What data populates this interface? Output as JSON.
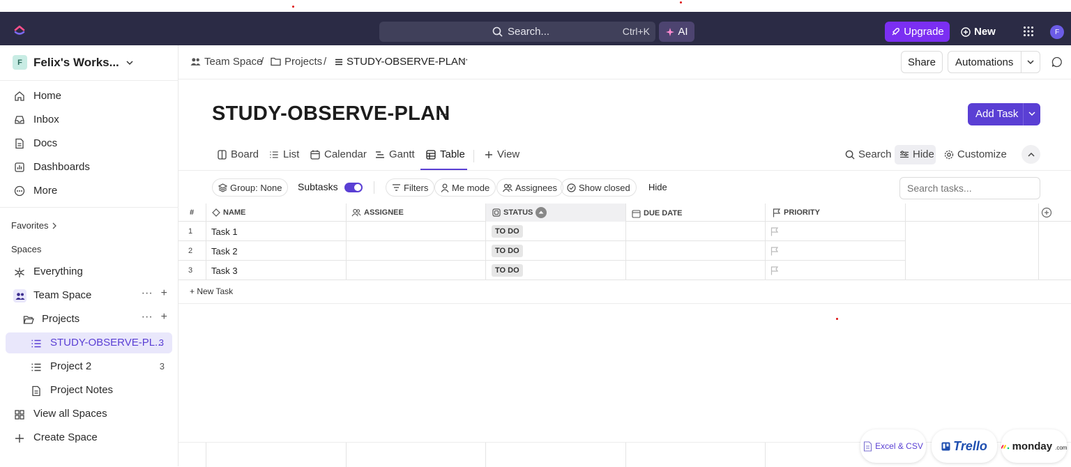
{
  "topbar": {
    "search_placeholder": "Search...",
    "search_shortcut": "Ctrl+K",
    "ai_label": "AI",
    "upgrade_label": "Upgrade",
    "new_label": "New",
    "avatar_initial": "F"
  },
  "sidebar": {
    "workspace_initial": "F",
    "workspace_name": "Felix's Works...",
    "nav": [
      {
        "label": "Home",
        "icon": "home-icon"
      },
      {
        "label": "Inbox",
        "icon": "inbox-icon"
      },
      {
        "label": "Docs",
        "icon": "doc-icon"
      },
      {
        "label": "Dashboards",
        "icon": "dashboard-icon"
      },
      {
        "label": "More",
        "icon": "more-icon"
      }
    ],
    "favorites_label": "Favorites",
    "spaces_label": "Spaces",
    "tree": {
      "everything": "Everything",
      "team_space": "Team Space",
      "projects": "Projects",
      "active_list": "STUDY-OBSERVE-PL...",
      "active_count": "3",
      "project2": "Project 2",
      "project2_count": "3",
      "project_notes": "Project Notes",
      "view_all": "View all Spaces",
      "create": "Create Space"
    }
  },
  "breadcrumb": {
    "team_space": "Team Space",
    "sep": "/",
    "projects": "Projects",
    "current": "STUDY-OBSERVE-PLAN"
  },
  "header_actions": {
    "share": "Share",
    "automations": "Automations"
  },
  "page": {
    "title": "STUDY-OBSERVE-PLAN",
    "add_task": "Add Task"
  },
  "views": {
    "tabs": [
      "Board",
      "List",
      "Calendar",
      "Gantt",
      "Table"
    ],
    "add_view": "View",
    "search": "Search",
    "hide": "Hide",
    "customize": "Customize"
  },
  "filters": {
    "group": "Group: None",
    "subtasks": "Subtasks",
    "filters": "Filters",
    "me_mode": "Me mode",
    "assignees": "Assignees",
    "show_closed": "Show closed",
    "hide": "Hide",
    "search_placeholder": "Search tasks..."
  },
  "table": {
    "columns": [
      "#",
      "Name",
      "Assignee",
      "Status",
      "Due Date",
      "Priority"
    ],
    "rows": [
      {
        "num": "1",
        "name": "Task 1",
        "status": "TO DO"
      },
      {
        "num": "2",
        "name": "Task 2",
        "status": "TO DO"
      },
      {
        "num": "3",
        "name": "Task 3",
        "status": "TO DO"
      }
    ],
    "new_task": "+ New Task"
  },
  "imports": {
    "excel": "Excel & CSV",
    "trello": "Trello",
    "monday": "monday",
    "monday_suffix": ".com"
  },
  "colors": {
    "accent": "#5a3fd4",
    "topbar": "#2b2b45",
    "upgrade": "#7b2ff2"
  }
}
